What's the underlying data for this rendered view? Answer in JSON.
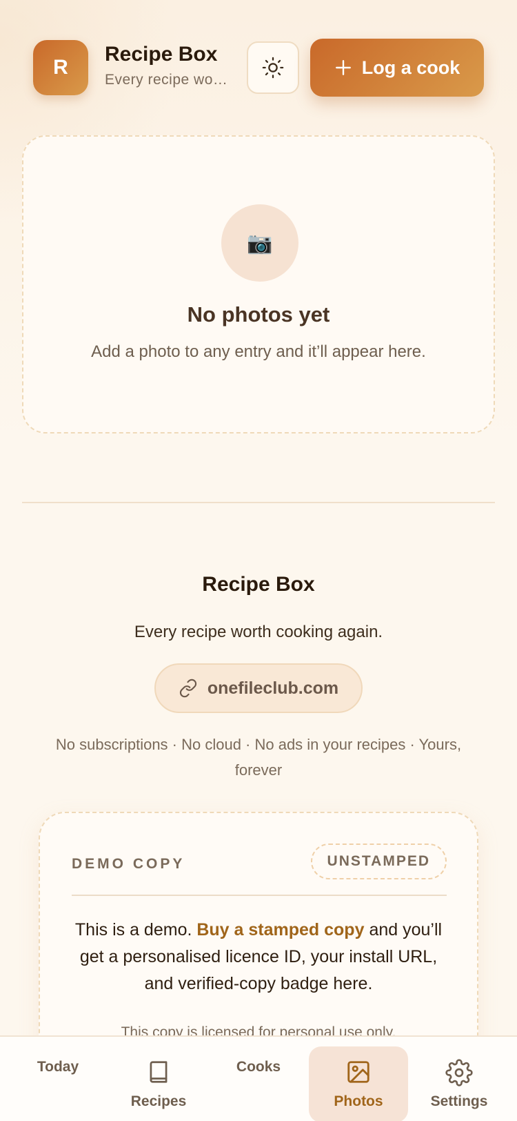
{
  "header": {
    "logo_letter": "R",
    "title": "Recipe Box",
    "subtitle": "Every recipe worth cooking again.",
    "theme_icon": "sun-icon",
    "log_cook_label": "Log a cook"
  },
  "empty_state": {
    "icon": "camera-icon",
    "icon_glyph": "📷",
    "title": "No photos yet",
    "text": "Add a photo to any entry and it’ll appear here."
  },
  "footer": {
    "title": "Recipe Box",
    "tagline": "Every recipe worth cooking again.",
    "site_label": "onefileclub.com",
    "notes": "No subscriptions · No cloud · No ads in your recipes · Yours, forever"
  },
  "demo": {
    "label": "DEMO COPY",
    "badge": "UNSTAMPED",
    "text_before": "This is a demo. ",
    "link": "Buy a stamped copy",
    "text_after": " and you’ll get a personalised licence ID, your install URL, and verified-copy badge here.",
    "license": "This copy is licensed for personal use only."
  },
  "nav": {
    "today": "Today",
    "recipes": "Recipes",
    "cooks": "Cooks",
    "photos": "Photos",
    "settings": "Settings",
    "active": "photos"
  },
  "colors": {
    "accent": "#c9692a",
    "accent_light": "#d99a4a",
    "link": "#a0651a",
    "background": "#fdf6ec"
  }
}
